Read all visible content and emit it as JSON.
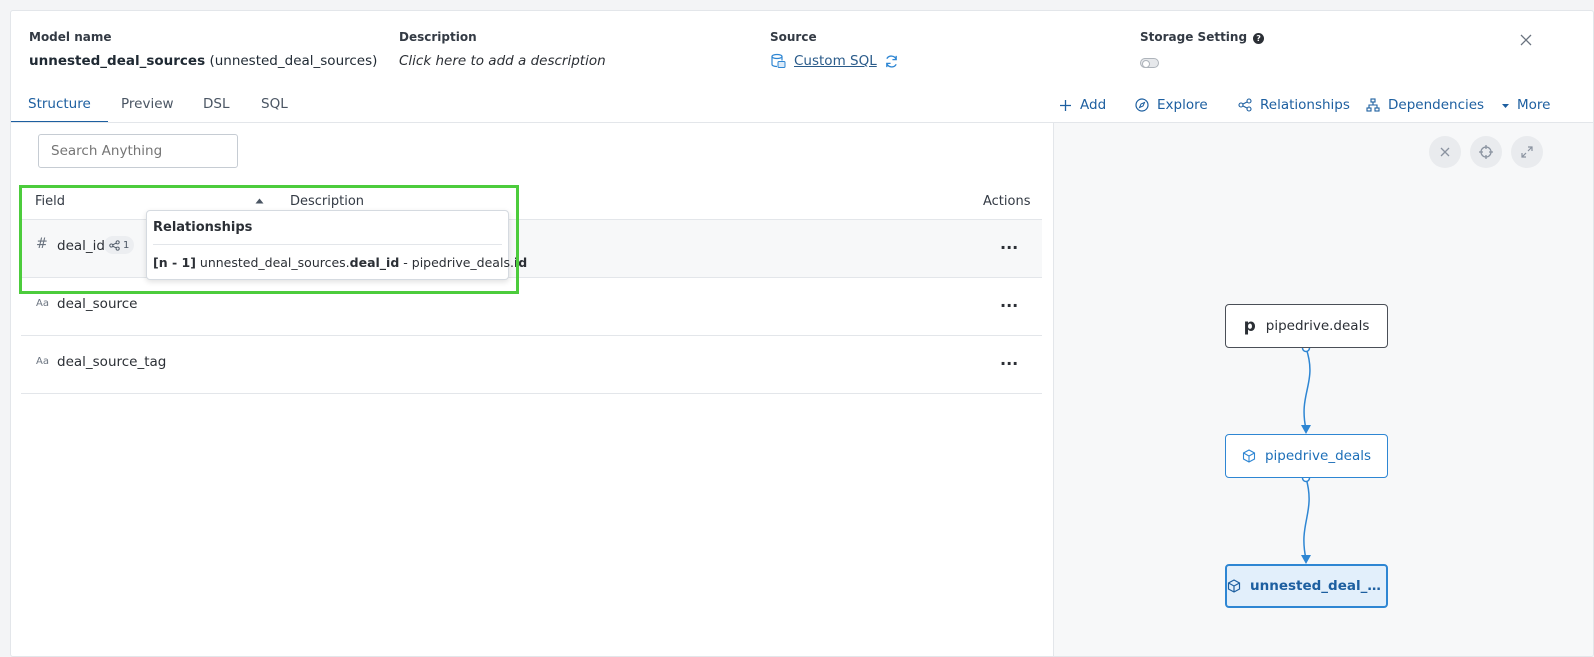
{
  "header": {
    "model_name_label": "Model name",
    "model_name": "unnested_deal_sources",
    "model_name_paren": "(unnested_deal_sources)",
    "description_label": "Description",
    "description_placeholder": "Click here to add a description",
    "source_label": "Source",
    "source_value": "Custom SQL",
    "storage_label": "Storage Setting",
    "storage_help": "?",
    "storage_enabled": false
  },
  "tabs": [
    {
      "label": "Structure",
      "active": true
    },
    {
      "label": "Preview",
      "active": false
    },
    {
      "label": "DSL",
      "active": false
    },
    {
      "label": "SQL",
      "active": false
    }
  ],
  "actions": {
    "add": "Add",
    "explore": "Explore",
    "relationships": "Relationships",
    "dependencies": "Dependencies",
    "more": "More"
  },
  "search": {
    "placeholder": "Search Anything"
  },
  "table": {
    "columns": {
      "field": "Field",
      "description": "Description",
      "actions": "Actions"
    },
    "rows": [
      {
        "type_icon": "#",
        "name": "deal_id",
        "relationship_count": "1",
        "menu": "···"
      },
      {
        "type_icon": "Aa",
        "name": "deal_source",
        "menu": "···"
      },
      {
        "type_icon": "Aa",
        "name": "deal_source_tag",
        "menu": "···"
      }
    ]
  },
  "popover": {
    "title": "Relationships",
    "cardinality": "[n - 1]",
    "from_model": "unnested_deal_sources.",
    "from_field": "deal_id",
    "separator": " - ",
    "to_model": "pipedrive_deals.",
    "to_field": "id"
  },
  "graph": {
    "nodes": [
      {
        "label": "pipedrive.deals",
        "kind": "source",
        "icon": "pipedrive-logo-icon",
        "logo_glyph": "p"
      },
      {
        "label": "pipedrive_deals",
        "kind": "model",
        "icon": "cube-icon"
      },
      {
        "label": "unnested_deal_s...",
        "kind": "current",
        "icon": "cube-icon"
      }
    ],
    "colors": {
      "accent": "#2e86d3",
      "highlight": "#4ccc3c"
    }
  }
}
